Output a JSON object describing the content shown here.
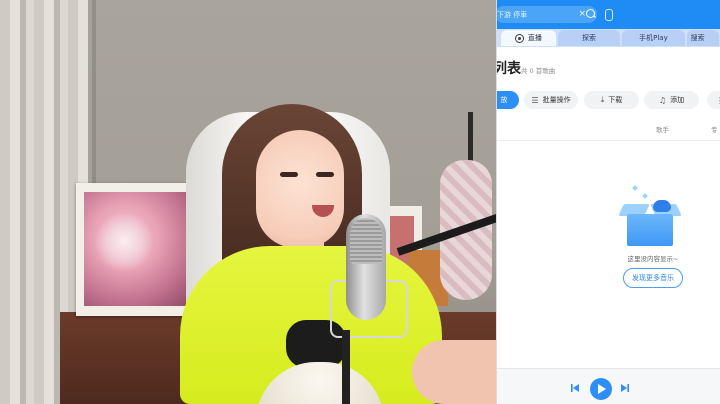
{
  "app": {
    "search": {
      "value": "下游 停車",
      "clear_label": "×"
    },
    "tabs": [
      {
        "label": "直播",
        "active": true
      },
      {
        "label": "探索",
        "active": false
      },
      {
        "label": "手机Play",
        "active": false
      },
      {
        "label": "搜索",
        "active": false
      }
    ],
    "page": {
      "title": "列表",
      "song_count": "共 0 首歌曲"
    },
    "toolbar": {
      "play_label": "放",
      "batch_label": "批量操作",
      "download_label": "下载",
      "add_label": "添加",
      "batch_icon": "list-icon",
      "download_icon": "download-icon",
      "add_icon": "music-note-icon"
    },
    "columns": {
      "singer": "歌手",
      "album": "专"
    },
    "empty_state": {
      "message": "这里没内容显示~",
      "button_label": "发现更多音乐"
    },
    "colors": {
      "accent": "#2d8ef6",
      "titlebar": "#1f8cf5",
      "tab_bar": "#cfe0fb"
    }
  }
}
